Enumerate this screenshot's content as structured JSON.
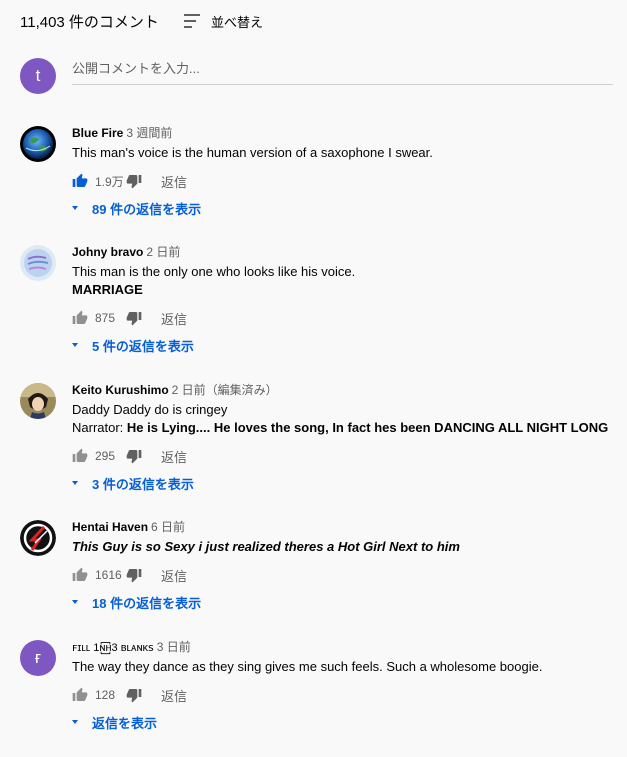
{
  "header": {
    "count": "11,403 件のコメント",
    "sort_label": "並べ替え"
  },
  "composer": {
    "avatar_letter": "t",
    "placeholder": "公開コメントを入力..."
  },
  "comments": [
    {
      "author": "Blue Fire",
      "time": "3 週間前",
      "text_lines": [
        "This man's voice is the human version of a saxophone I swear."
      ],
      "likes": "1.9万",
      "reply_label": "返信",
      "replies_label": "89 件の返信を表示",
      "liked": true
    },
    {
      "author": "Johny bravo",
      "time": "2 日前",
      "text_lines": [
        "This man is the only one who looks like his voice.",
        "MARRIAGE"
      ],
      "likes": "875",
      "reply_label": "返信",
      "replies_label": "5 件の返信を表示"
    },
    {
      "author": "Keito Kurushimo",
      "time": "2 日前（編集済み）",
      "text_lines": [
        "Daddy Daddy do is cringey"
      ],
      "narrator_label": "Narrator:",
      "narrator_text": "He is Lying.... He loves the song, In fact hes been DANCING ALL NIGHT LONG",
      "likes": "295",
      "reply_label": "返信",
      "replies_label": "3 件の返信を表示"
    },
    {
      "author": "Hentai Haven",
      "time": "6 日前",
      "text_lines": [
        "This Guy is so Sexy i just realized theres a Hot Girl Next to him"
      ],
      "likes": "1616",
      "reply_label": "返信",
      "replies_label": "18 件の返信を表示"
    },
    {
      "author": "ꜰɪʟʟ 1ɴ꙱ʜ3 ʙʟᴀɴᴋꜱ",
      "time": "3 日前",
      "avatar_letter": "ғ",
      "text_lines": [
        "The way they dance as they sing gives me such feels. Such a wholesome boogie."
      ],
      "likes": "128",
      "reply_label": "返信",
      "replies_label": "返信を表示"
    }
  ],
  "colors": {
    "accent": "#065fd4",
    "avatar_purple": "#7e57c2",
    "secondary_text": "#606060"
  }
}
